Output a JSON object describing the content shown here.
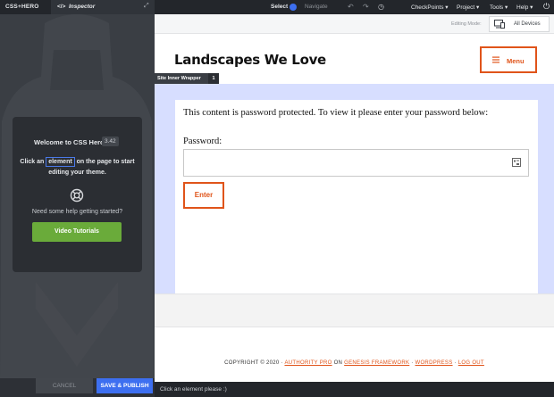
{
  "topbar": {
    "brand": "CSS+HERO",
    "tab_code": "</>",
    "tab_label": "Inspector",
    "select_label": "Select",
    "navigate_label": "Navigate",
    "menus": [
      "CheckPoints",
      "Project",
      "Tools",
      "Help"
    ]
  },
  "welcome": {
    "title": "Welcome to CSS Hero",
    "version": "3.42",
    "line1_pre": "Click an",
    "line1_element": "element",
    "line1_post": "on the page to start",
    "line2": "editing your theme.",
    "help": "Need some help getting started?",
    "video_button": "Video Tutorials"
  },
  "footer_buttons": {
    "cancel": "CANCEL",
    "publish": "SAVE & PUBLISH"
  },
  "modebar": {
    "label": "Editing Mode:",
    "device": "All Devices"
  },
  "site": {
    "title": "Landscapes We Love",
    "menu_button": "Menu",
    "wrapper_tag": "Site Inner Wrapper",
    "wrapper_count": "1",
    "protected_text": "This content is password protected. To view it please enter your password below:",
    "password_label": "Password:",
    "enter_button": "Enter"
  },
  "footer": {
    "prefix": "COPYRIGHT © 2020 · ",
    "link1": "AUTHORITY PRO",
    "mid": " ON ",
    "link2": "GENESIS FRAMEWORK",
    "sep1": " · ",
    "link3": "WORDPRESS",
    "sep2": " · ",
    "link4": "LOG OUT"
  },
  "status": "Click an element please :)",
  "colors": {
    "accent_blue": "#3d6ff0",
    "accent_orange": "#e0541a",
    "green": "#6aab3a",
    "inner_wrapper_highlight": "#d7deff"
  }
}
